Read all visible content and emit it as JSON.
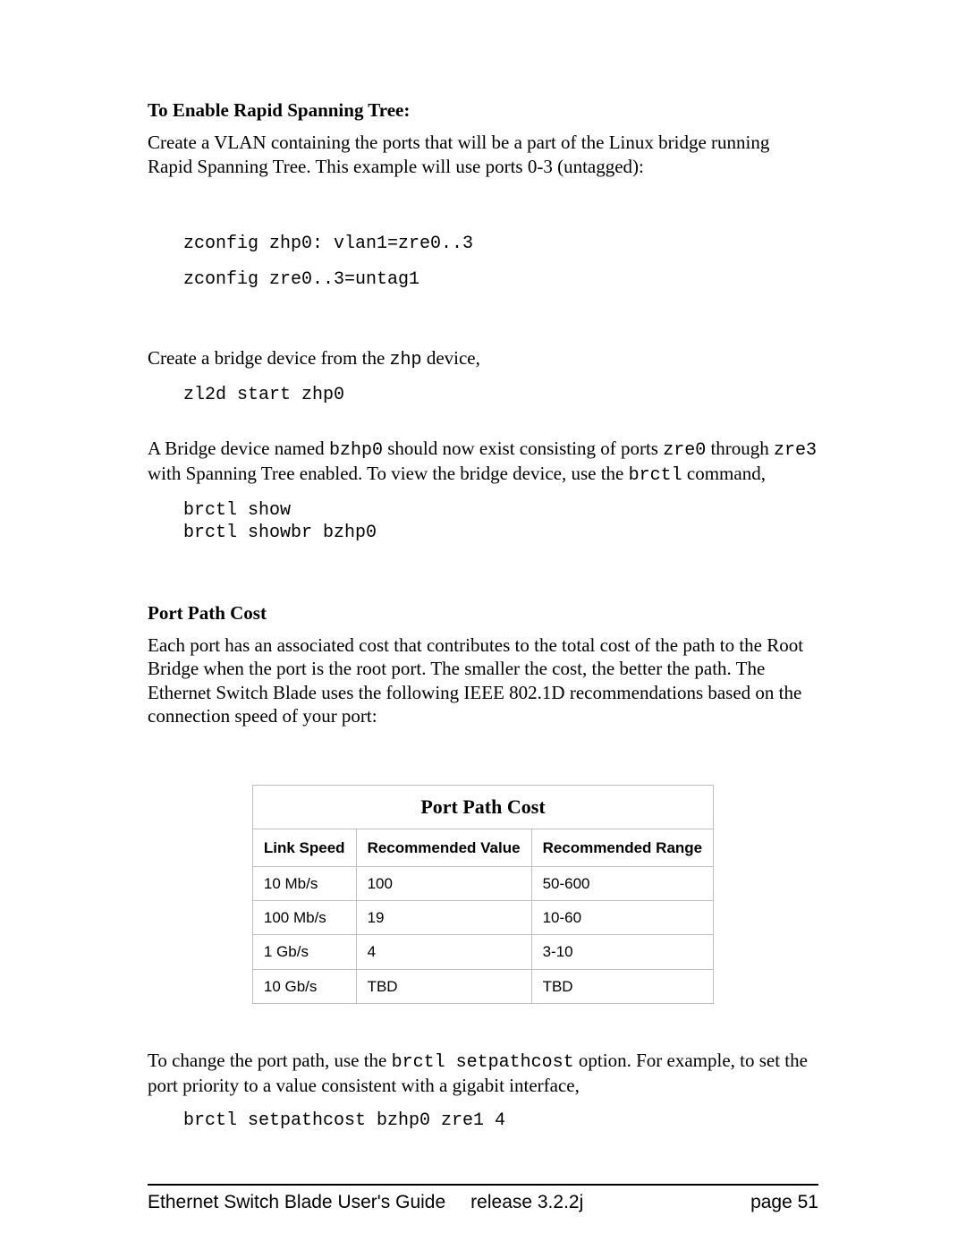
{
  "section1": {
    "heading": "To Enable Rapid Spanning Tree:",
    "para1": "Create a VLAN containing the ports that will be a part of the Linux bridge running Rapid Spanning Tree. This example will use ports 0-3 (untagged):",
    "code1_l1": "zconfig zhp0: vlan1=zre0..3",
    "code1_l2": "zconfig zre0..3=untag1",
    "para2_pre": "Create a bridge device from the ",
    "para2_code": "zhp",
    "para2_post": " device,",
    "code2": "zl2d start zhp0",
    "para3_pre": "A Bridge device named ",
    "para3_code1": "bzhp0",
    "para3_mid1": " should now exist consisting of ports ",
    "para3_code2": "zre0",
    "para3_mid2": " through ",
    "para3_code3": "zre3",
    "para3_mid3": " with Spanning Tree enabled. To view the bridge device, use the ",
    "para3_code4": "brctl",
    "para3_post": " command,",
    "code3_l1": "brctl show",
    "code3_l2": "brctl showbr bzhp0"
  },
  "section2": {
    "heading": "Port Path Cost",
    "para1": "Each port has an associated cost that contributes to the total cost of the path to the Root Bridge when the port is the root port. The smaller the cost, the better the path. The Ethernet Switch Blade uses the following IEEE 802.1D recommendations based on the connection speed of your port:"
  },
  "chart_data": {
    "type": "table",
    "title": "Port Path Cost",
    "columns": [
      "Link Speed",
      "Recommended Value",
      "Recommended Range"
    ],
    "rows": [
      [
        "10 Mb/s",
        "100",
        "50-600"
      ],
      [
        "100 Mb/s",
        "19",
        "10-60"
      ],
      [
        "1 Gb/s",
        "4",
        "3-10"
      ],
      [
        "10 Gb/s",
        "TBD",
        "TBD"
      ]
    ]
  },
  "section3": {
    "para_pre": "To change the port path, use the ",
    "para_code": "brctl setpathcost",
    "para_post": " option. For example, to set the port priority to a value consistent with a gigabit interface,",
    "code": "brctl setpathcost bzhp0 zre1 4"
  },
  "footer": {
    "doc_title": "Ethernet Switch Blade User's Guide",
    "release": "release  3.2.2j",
    "page": "page 51"
  }
}
